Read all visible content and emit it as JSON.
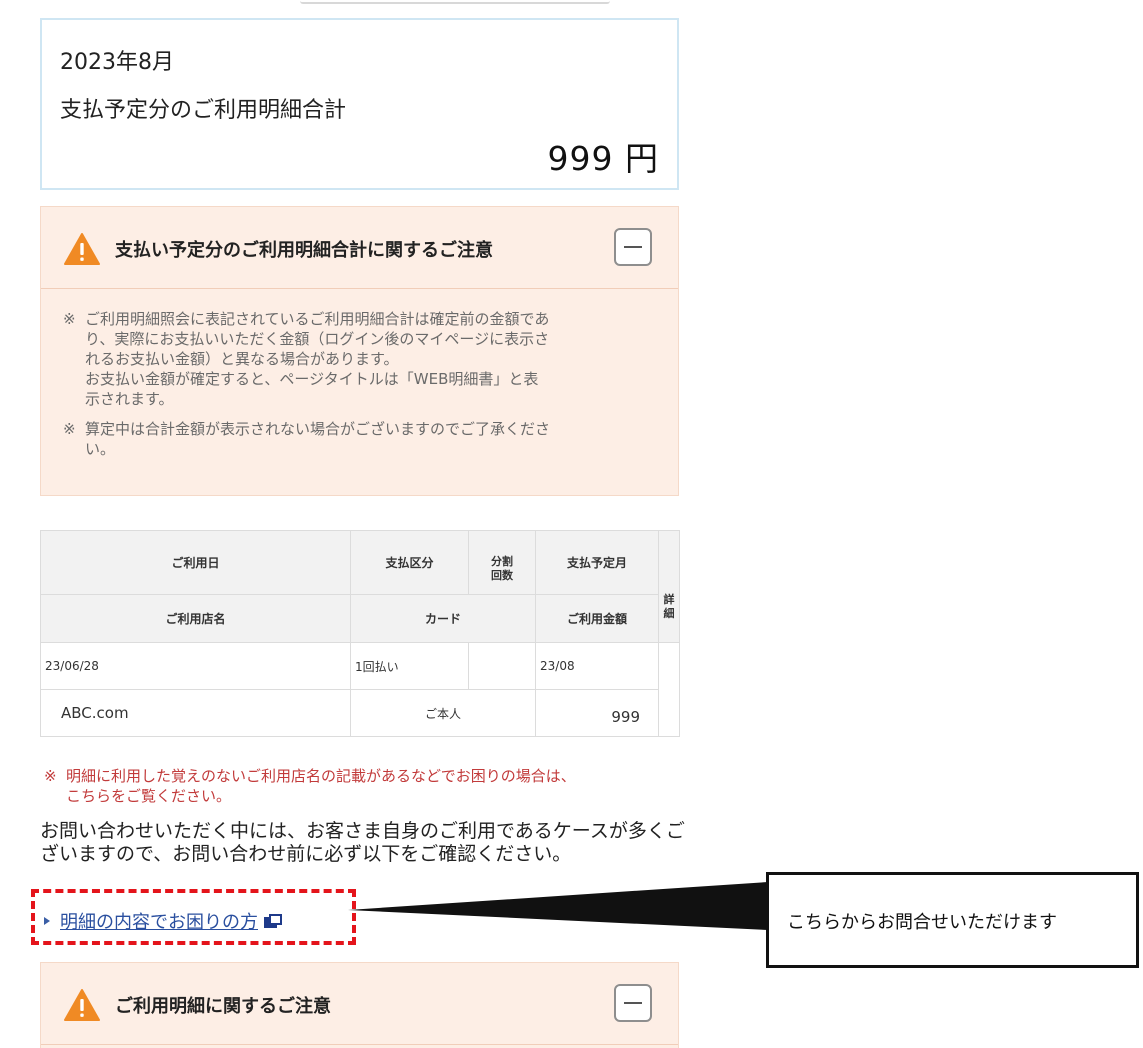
{
  "summary": {
    "month": "2023年8月",
    "label": "支払予定分のご利用明細合計",
    "amount": "999 円"
  },
  "notice_total": {
    "title": "支払い予定分のご利用明細合計に関するご注意",
    "notes": [
      {
        "mark": "※",
        "lines": [
          "ご利用明細照会に表記されているご利用明細合計は確定前の金額であ",
          "り、実際にお支払いいただく金額（ログイン後のマイページに表示さ",
          "れるお支払い金額）と異なる場合があります。",
          "お支払い金額が確定すると、ページタイトルは「WEB明細書」と表",
          "示されます。"
        ]
      },
      {
        "mark": "※",
        "lines": [
          "算定中は合計金額が表示されない場合がございますのでご了承くださ",
          "い。"
        ]
      }
    ]
  },
  "table": {
    "headers_row1": {
      "date": "ご利用日",
      "payment_type": "支払区分",
      "installments": "分割回数",
      "installments_line1": "分割",
      "installments_line2": "回数",
      "payment_month": "支払予定月",
      "detail_line1": "詳",
      "detail_line2": "細"
    },
    "headers_row2": {
      "store": "ご利用店名",
      "card": "カード",
      "amount": "ご利用金額"
    },
    "rows": [
      {
        "date": "23/06/28",
        "payment_type": "1回払い",
        "installments": "",
        "payment_month": "23/08",
        "store": "ABC.com",
        "card": "ご本人",
        "amount": "999"
      }
    ]
  },
  "red_notice": {
    "mark": "※",
    "lines": [
      "明細に利用した覚えのないご利用店名の記載があるなどでお困りの場合は、",
      "こちらをご覧ください。"
    ]
  },
  "confirm_text": "お問い合わせいただく中には、お客さま自身のご利用であるケースが多くございますので、お問い合わせ前に必ず以下をご確認ください。",
  "inquiry_link": "明細の内容でお困りの方",
  "callout": "こちらからお問合せいただけます",
  "notice_usage": {
    "title": "ご利用明細に関するご注意"
  },
  "colors": {
    "notice_bg": "#fdeee5",
    "warning": "#f08a24",
    "link": "#2a4f9f",
    "highlight": "#e4141b",
    "red_text": "#c23b3b"
  }
}
